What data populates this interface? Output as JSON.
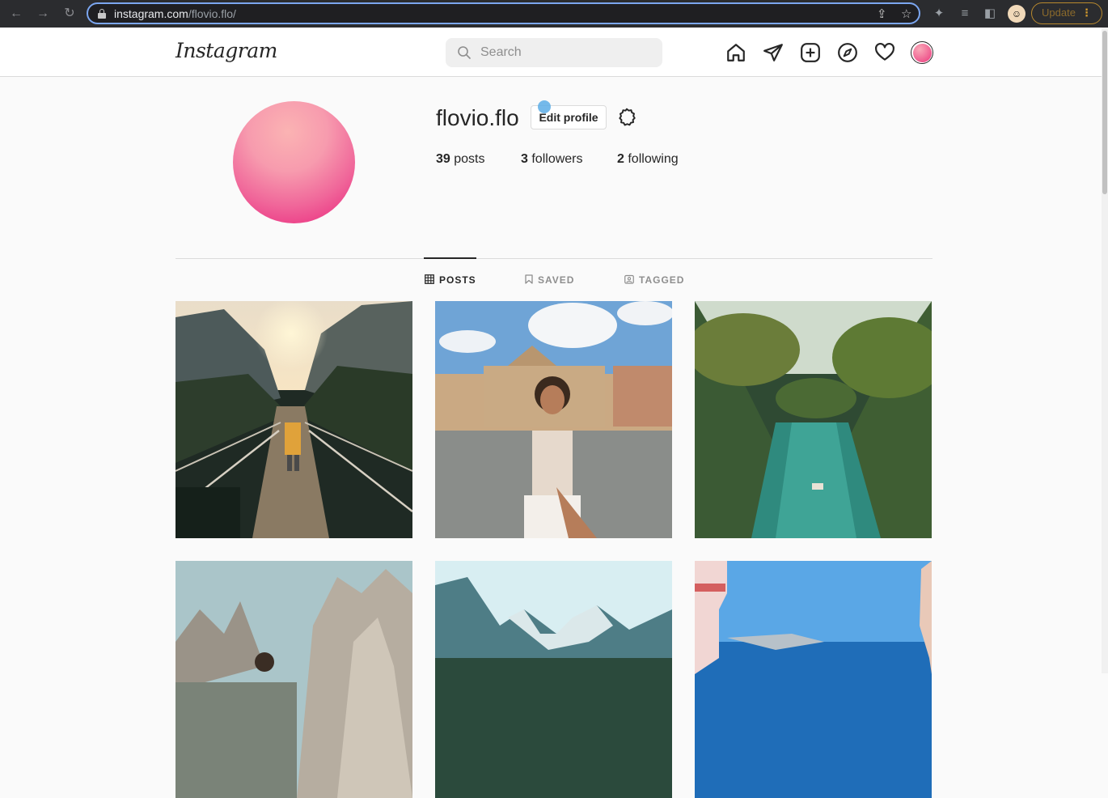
{
  "browser": {
    "url_host": "instagram.com",
    "url_path": "/flovio.flo/",
    "update_label": "Update"
  },
  "header": {
    "logo": "Instagram",
    "search_placeholder": "Search",
    "icons": [
      "home-icon",
      "direct-message-icon",
      "new-post-icon",
      "explore-icon",
      "activity-heart-icon",
      "profile-avatar"
    ]
  },
  "profile": {
    "username": "flovio.flo",
    "edit_label": "Edit profile",
    "stats": {
      "posts_count": "39",
      "posts_label": "posts",
      "followers_count": "3",
      "followers_label": "followers",
      "following_count": "2",
      "following_label": "following"
    }
  },
  "tabs": [
    {
      "label": "POSTS",
      "active": true
    },
    {
      "label": "SAVED",
      "active": false
    },
    {
      "label": "TAGGED",
      "active": false
    }
  ],
  "posts": [
    {
      "subject": "suspension-bridge-hiker"
    },
    {
      "subject": "woman-st-peters-square"
    },
    {
      "subject": "tropical-river-palms"
    },
    {
      "subject": "dolomites-mountains"
    },
    {
      "subject": "turquoise-mountain-lake"
    },
    {
      "subject": "santorini-sea-view"
    }
  ],
  "colors": {
    "accent_border": "#dbdbdb",
    "text": "#262626",
    "muted": "#8e8e8e",
    "avatar_pink": "#e9207a"
  }
}
